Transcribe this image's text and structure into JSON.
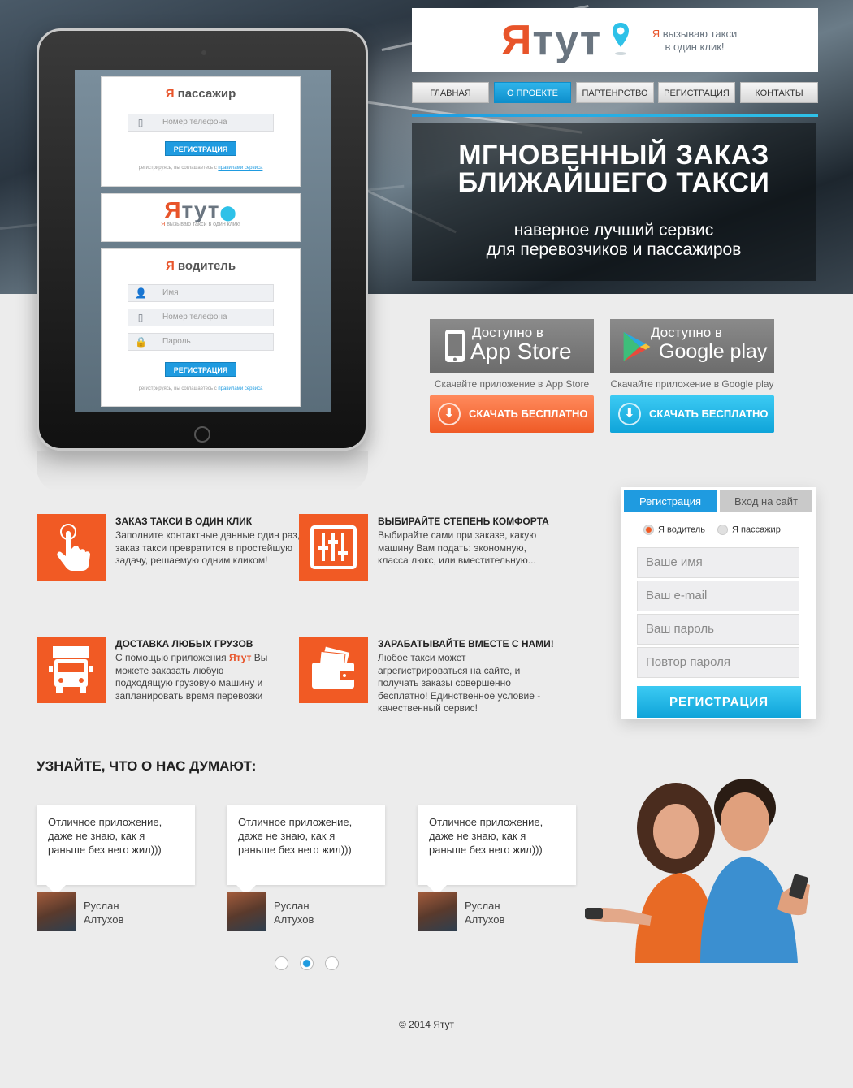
{
  "logo": {
    "word": "Ятут",
    "word_red": "Я",
    "word_grey": "тут",
    "tagline_ya": "Я",
    "tagline_rest": " вызываю такси",
    "tagline_line2": "в один клик!"
  },
  "nav": {
    "items": [
      "ГЛАВНАЯ",
      "О ПРОЕКТЕ",
      "ПАРТЕНРСТВО",
      "РЕГИСТРАЦИЯ",
      "КОНТАКТЫ"
    ],
    "active": "О ПРОЕКТЕ"
  },
  "hero": {
    "title": "МГНОВЕННЫЙ ЗАКАЗ\nБЛИЖАЙШЕГО ТАКСИ",
    "subtitle": "наверное лучший сервис\nдля перевозчиков и пассажиров"
  },
  "tablet": {
    "passenger": {
      "title_ya": "Я",
      "title_rest": " пассажир",
      "phone_placeholder": "Номер телефона",
      "button": "РЕГИСТРАЦИЯ",
      "note": "регистрируясь, вы соглашаетесь с",
      "note_link": "правилами сервиса"
    },
    "logo": {
      "word_red": "Я",
      "word_grey": "тут",
      "tagline_ya": "Я",
      "tagline_rest": " вызываю такси в один клик!"
    },
    "driver": {
      "title_ya": "Я",
      "title_rest": " водитель",
      "name_placeholder": "Имя",
      "phone_placeholder": "Номер телефона",
      "password_placeholder": "Пароль",
      "button": "РЕГИСТРАЦИЯ",
      "note": "регистрируясь, вы соглашаетесь с",
      "note_link": "правилами сервиса"
    }
  },
  "apps": {
    "appstore": {
      "small": "Доступно в",
      "big": "App Store",
      "caption": "Скачайте приложение в App Store",
      "button": "СКАЧАТЬ БЕСПЛАТНО"
    },
    "googleplay": {
      "small": "Доступно в",
      "big": "Google play",
      "caption": "Скачайте приложение в Google play",
      "button": "СКАЧАТЬ БЕСПЛАТНО"
    }
  },
  "features": [
    {
      "icon": "hand-tap-icon",
      "title": "ЗАКАЗ ТАКСИ В ОДИН КЛИК",
      "text": "Заполните контактные данные один раз,  и заказ такси превратится в простейшую задачу, решаемую одним кликом!"
    },
    {
      "icon": "sliders-icon",
      "title": "ВЫБИРАЙТЕ СТЕПЕНЬ КОМФОРТА",
      "text": "Выбирайте сами при заказе, какую машину Вам подать: экономную, класса люкс, или вместительную..."
    },
    {
      "icon": "truck-icon",
      "title": "ДОСТАВКА ЛЮБЫХ ГРУЗОВ",
      "text_before": "С помощью приложения ",
      "text_brand": "Ятут",
      "text_after": " Вы можете заказать любую подходящую грузовую машину и запланировать время перевозки"
    },
    {
      "icon": "wallet-icon",
      "title": "ЗАРАБАТЫВАЙТЕ ВМЕСТЕ С НАМИ!",
      "text": "Любое такси может агрегистрироваться на сайте, и получать заказы совершенно бесплатно! Единственное условие - качественный сервис!"
    }
  ],
  "form": {
    "tab_register": "Регистрация",
    "tab_login": "Вход на сайт",
    "radio_driver": "Я водитель",
    "radio_passenger": "Я пассажир",
    "name_placeholder": "Ваше имя",
    "email_placeholder": "Ваш e-mail",
    "password_placeholder": "Ваш пароль",
    "repeat_placeholder": "Повтор пароля",
    "submit": "РЕГИСТРАЦИЯ"
  },
  "reviews": {
    "title": "УЗНАЙТЕ, ЧТО О НАС ДУМАЮТ:",
    "items": [
      {
        "text": "Отличное приложение, даже не знаю,  как я раньше без него жил)))",
        "first": "Руслан",
        "last": "Алтухов"
      },
      {
        "text": "Отличное приложение, даже не знаю,  как я раньше без него жил)))",
        "first": "Руслан",
        "last": "Алтухов"
      },
      {
        "text": "Отличное приложение, даже не знаю,  как я раньше без него жил)))",
        "first": "Руслан",
        "last": "Алтухов"
      }
    ],
    "current_page": 2,
    "total_pages": 3
  },
  "footer": {
    "copyright": "© 2014 Ятут"
  },
  "colors": {
    "brand_orange": "#f15a24",
    "brand_blue": "#1f9be0",
    "logo_grey": "#6a7580"
  }
}
